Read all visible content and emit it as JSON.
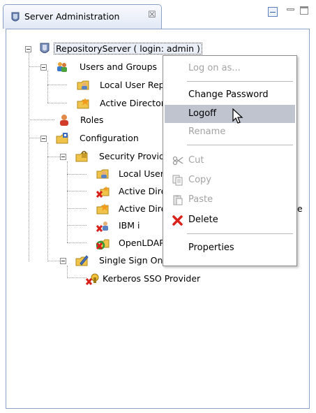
{
  "tab": {
    "title": "Server Administration",
    "close_glyph": "☒",
    "icon": "server-admin-icon"
  },
  "tree": {
    "root": {
      "label": "RepositoryServer ( login: admin )",
      "icon": "repository-server-icon"
    },
    "users_and_groups": {
      "label": "Users and Groups",
      "icon": "users-and-groups-icon"
    },
    "local_user_repository": {
      "label": "Local User Repository",
      "icon": "folder-user-icon"
    },
    "active_directory": {
      "label": "Active Directory",
      "icon": "folder-star-icon"
    },
    "roles": {
      "label": "Roles",
      "icon": "roles-icon"
    },
    "configuration": {
      "label": "Configuration",
      "icon": "configuration-folder-icon"
    },
    "security_providers": {
      "label": "Security Providers",
      "icon": "security-folder-icon"
    },
    "sp_local_user": {
      "label": "Local User",
      "icon": "folder-user-icon"
    },
    "sp_active_directory_1": {
      "label": "Active Directory",
      "icon": "provider-error-icon"
    },
    "sp_active_directory_2": {
      "label": "Active Directory",
      "icon": "folder-star-icon"
    },
    "sp_active_directory_2_trailing": "e",
    "sp_ibm_i": {
      "label": "IBM i",
      "icon": "provider-error-icon"
    },
    "sp_openldap": {
      "label": "OpenLDAP",
      "icon": "provider-sync-icon"
    },
    "single_sign_on": {
      "label": "Single Sign On",
      "icon": "sso-folder-icon"
    },
    "kerberos": {
      "label": "Kerberos SSO Provider",
      "icon": "kerberos-error-icon"
    }
  },
  "context_menu": {
    "log_on_as": "Log on as...",
    "change_password": "Change Password",
    "logoff": "Logoff",
    "rename": "Rename",
    "cut": "Cut",
    "copy": "Copy",
    "paste": "Paste",
    "delete": "Delete",
    "properties": "Properties"
  },
  "colors": {
    "menu_hover": "#bfc4cf",
    "disabled_text": "#a3a3a3",
    "tab_border": "#8ca1c7"
  }
}
